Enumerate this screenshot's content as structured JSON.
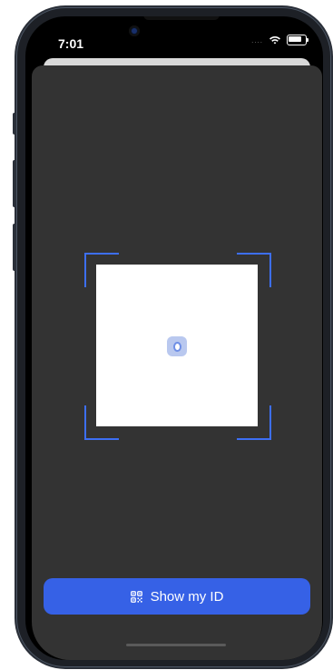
{
  "status_bar": {
    "time": "7:01",
    "signal_indicator": "....",
    "wifi_icon": "wifi-icon",
    "battery_icon": "battery-icon",
    "battery_level": 0.85
  },
  "scanner": {
    "frame_color": "#3d6ff4",
    "logo_icon": "app-logo-icon"
  },
  "actions": {
    "show_id_label": "Show my ID",
    "show_id_icon": "qr-code-icon"
  },
  "colors": {
    "sheet_background": "#333333",
    "button_primary": "#3661e6"
  }
}
